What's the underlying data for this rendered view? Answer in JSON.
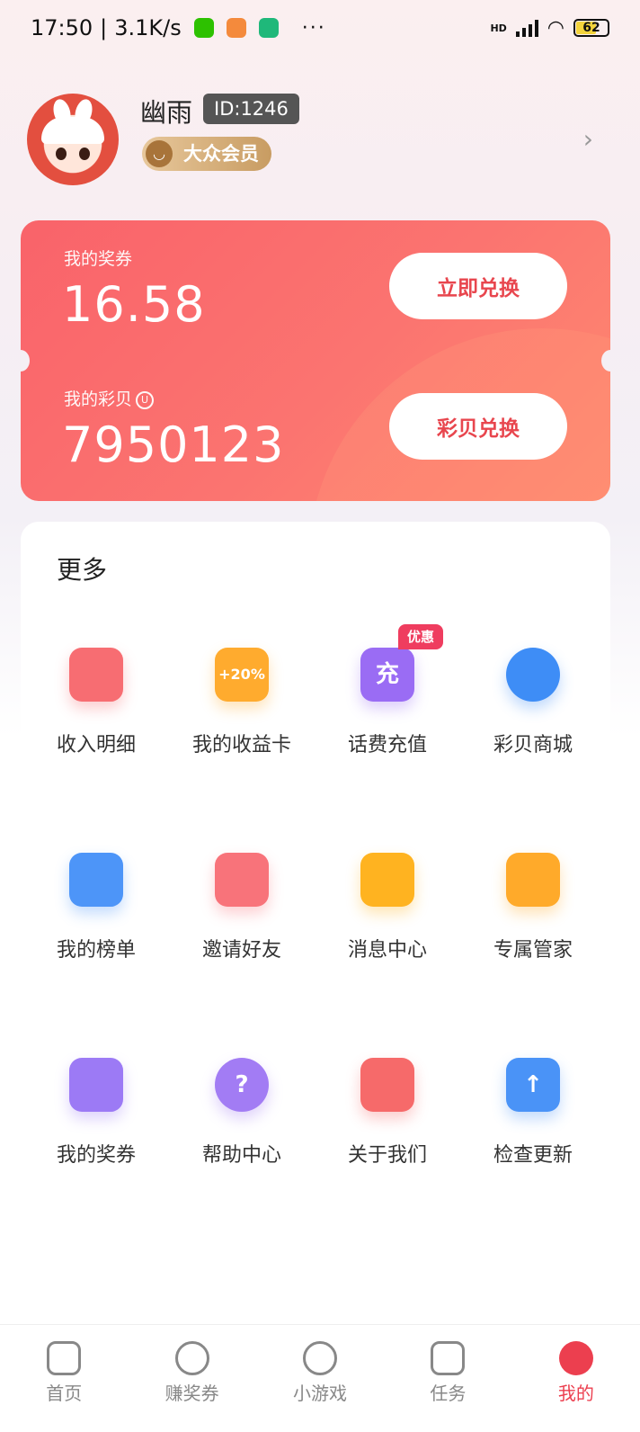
{
  "status_bar": {
    "time": "17:50",
    "net_speed": "3.1K/s",
    "dots": "···",
    "network": "HD",
    "battery": "62"
  },
  "profile": {
    "username": "幽雨",
    "id": "ID:1246",
    "member_level": "大众会员"
  },
  "wallet": {
    "voucher_label": "我的奖券",
    "voucher_value": "16.58",
    "voucher_button": "立即兑换",
    "shell_label": "我的彩贝",
    "shell_value": "7950123",
    "shell_button": "彩贝兑换"
  },
  "more": {
    "title": "更多",
    "items": [
      {
        "label": "收入明细",
        "icon": "receipt-icon",
        "color": "#f76d72"
      },
      {
        "label": "我的收益卡",
        "icon": "bonus-card-icon",
        "glyph": "+20%",
        "color": "#ffab2e"
      },
      {
        "label": "话费充值",
        "icon": "phone-recharge-icon",
        "glyph": "充",
        "badge": "优惠",
        "color": "#9a6cf4"
      },
      {
        "label": "彩贝商城",
        "icon": "shell-mall-icon",
        "color": "#3e8df6"
      },
      {
        "label": "我的榜单",
        "icon": "ranking-icon",
        "color": "#4d95f8"
      },
      {
        "label": "邀请好友",
        "icon": "invite-envelope-icon",
        "color": "#f8737a"
      },
      {
        "label": "消息中心",
        "icon": "bell-icon",
        "color": "#ffb320"
      },
      {
        "label": "专属管家",
        "icon": "butler-icon",
        "color": "#ffaa2a"
      },
      {
        "label": "我的奖券",
        "icon": "ticket-icon",
        "color": "#9c7af5"
      },
      {
        "label": "帮助中心",
        "icon": "help-icon",
        "glyph": "?",
        "color": "#a27cf4"
      },
      {
        "label": "关于我们",
        "icon": "mascot-icon",
        "color": "#f66a6a"
      },
      {
        "label": "检查更新",
        "icon": "update-arrow-icon",
        "glyph": "↑",
        "color": "#4a93f7"
      }
    ]
  },
  "bottom_nav": [
    {
      "label": "首页",
      "icon": "home-icon"
    },
    {
      "label": "赚奖券",
      "icon": "money-bag-icon"
    },
    {
      "label": "小游戏",
      "icon": "game-icon"
    },
    {
      "label": "任务",
      "icon": "calendar-task-icon"
    },
    {
      "label": "我的",
      "icon": "profile-icon",
      "active": true
    }
  ],
  "colors": {
    "accent": "#ec3f4f",
    "card": "#f9636a"
  }
}
